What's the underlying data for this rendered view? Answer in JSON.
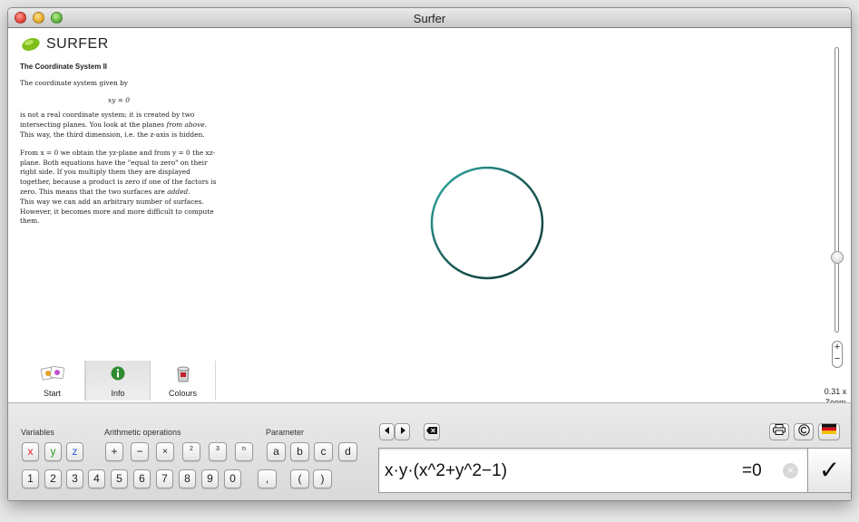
{
  "window": {
    "title": "Surfer"
  },
  "logo": {
    "name": "SURFER"
  },
  "info": {
    "heading": "The Coordinate System II",
    "p1": "The coordinate system given by",
    "equation": "xy = 0",
    "p2a": "is not a real coordinate system; it is created by two intersecting planes. You look at the planes ",
    "p2b": "from above",
    "p2c": ". This way, the third dimension, i.e. the z-axis is hidden.",
    "p3a": "From x = 0 we obtain the yz-plane and from y = 0 the xz-plane. Both equations have the \"equal to zero\" on their right side. If you multiply them they are displayed together, because a product is zero if one of the factors is zero. This means that the two surfaces are ",
    "p3b": "added",
    "p3c": ".",
    "p4": "This way we can add an arbitrary number of surfaces. However, it becomes more and more difficult to compute them."
  },
  "tabs": [
    {
      "label": "Start",
      "icon": "start-gallery-icon"
    },
    {
      "label": "Info",
      "icon": "info-icon"
    },
    {
      "label": "Colours",
      "icon": "paint-bucket-icon"
    }
  ],
  "zoom": {
    "plus": "+",
    "minus": "−",
    "value": "0.31 x",
    "label": "Zoom",
    "level_fraction": 0.36
  },
  "keyboard": {
    "variables_label": "Variables",
    "arith_label": "Arithmetic operations",
    "param_label": "Parameter",
    "vars": [
      "x",
      "y",
      "z"
    ],
    "ops": [
      "+",
      "−",
      "×"
    ],
    "exps": [
      "2",
      "3",
      "n"
    ],
    "params": [
      "a",
      "b",
      "c",
      "d"
    ],
    "digits": [
      "1",
      "2",
      "3",
      "4",
      "5",
      "6",
      "7",
      "8",
      "9",
      "0"
    ],
    "comma": ",",
    "paren_open": "(",
    "paren_close": ")"
  },
  "formula": {
    "text": "x·y·(x^2+y^2−1)",
    "equals": "=0",
    "clear": "×"
  },
  "check": "✓",
  "colors": {
    "x": "#e0202a",
    "y": "#2f9a2a",
    "z": "#2a5ad8",
    "surface": "#2a9e92",
    "surface_dark": "#143c3a",
    "info_green": "#2e8b2e"
  }
}
